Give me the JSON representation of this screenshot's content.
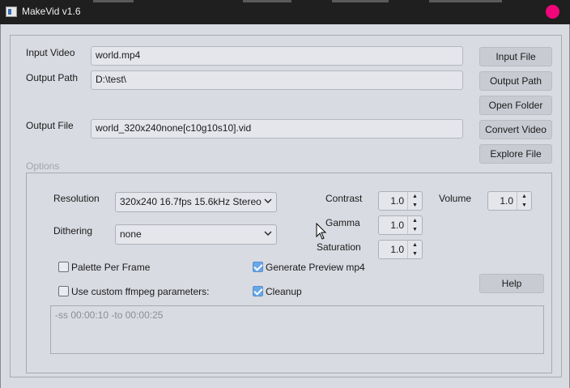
{
  "window": {
    "title": "MakeVid v1.6"
  },
  "files": {
    "input_video_label": "Input Video",
    "input_video_value": "world.mp4",
    "output_path_label": "Output Path",
    "output_path_value": "D:\\test\\",
    "output_file_label": "Output File",
    "output_file_value": "world_320x240none[c10g10s10].vid"
  },
  "buttons": {
    "input_file": "Input File",
    "output_path": "Output Path",
    "open_folder": "Open Folder",
    "convert_video": "Convert Video",
    "explore_file": "Explore File",
    "help": "Help"
  },
  "options": {
    "group_title": "Options",
    "resolution_label": "Resolution",
    "resolution_value": "320x240 16.7fps 15.6kHz Stereo",
    "dithering_label": "Dithering",
    "dithering_value": "none",
    "contrast_label": "Contrast",
    "contrast_value": "1.0",
    "gamma_label": "Gamma",
    "gamma_value": "1.0",
    "saturation_label": "Saturation",
    "saturation_value": "1.0",
    "volume_label": "Volume",
    "volume_value": "1.0",
    "palette_per_frame_label": "Palette Per Frame",
    "palette_per_frame_checked": false,
    "generate_preview_label": "Generate Preview mp4",
    "generate_preview_checked": true,
    "custom_ffmpeg_label": "Use custom ffmpeg parameters:",
    "custom_ffmpeg_checked": false,
    "cleanup_label": "Cleanup",
    "cleanup_checked": true,
    "ffmpeg_params_value": "-ss 00:00:10 -to 00:00:25"
  },
  "colors": {
    "window_bg": "#d9dbe2",
    "titlebar_bg": "#1f1f1f",
    "button_bg": "#c9cbd3",
    "checkbox_checked": "#68a7e8",
    "record_indicator": "#f0067a"
  },
  "icons": {
    "app": "app-icon",
    "record": "record-indicator-icon",
    "dropdown": "chevron-down-icon",
    "spin_up": "arrow-up-icon",
    "spin_down": "arrow-down-icon",
    "cursor": "mouse-cursor-icon"
  }
}
